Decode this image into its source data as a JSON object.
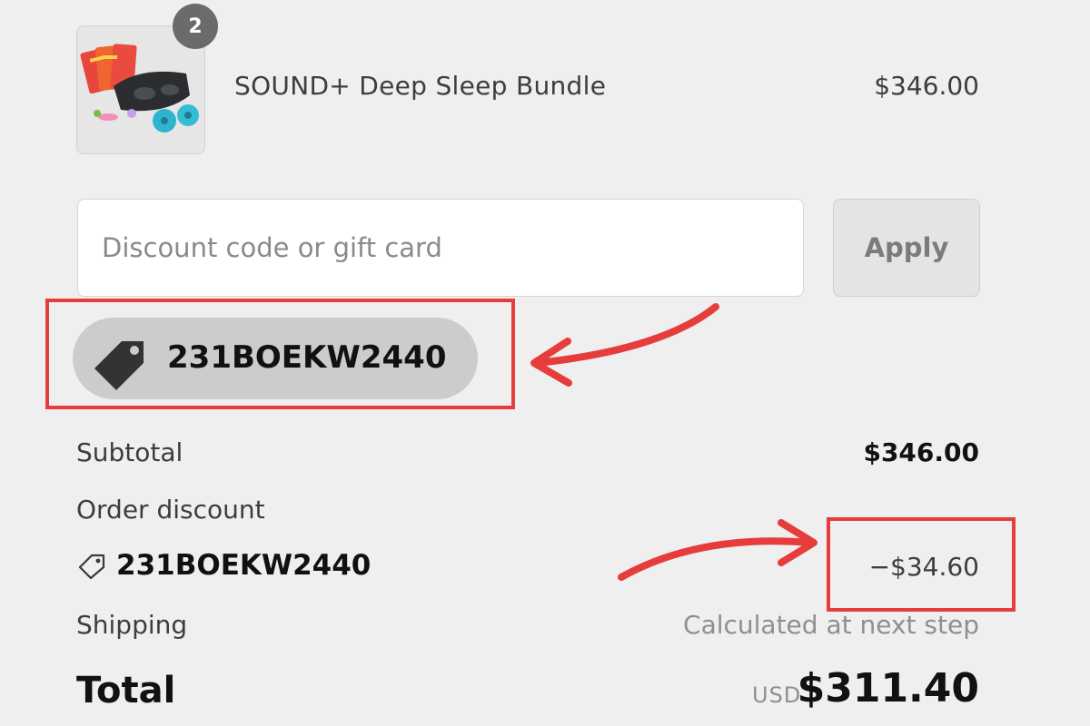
{
  "product": {
    "quantity": "2",
    "name": "SOUND+ Deep Sleep Bundle",
    "price": "$346.00",
    "image_icon": "product-bundle-image"
  },
  "discount": {
    "placeholder": "Discount code or gift card",
    "value": "",
    "apply_label": "Apply"
  },
  "applied_code": {
    "code": "231BOEKW2440",
    "icon": "tag-icon"
  },
  "summary": {
    "subtotal_label": "Subtotal",
    "subtotal_value": "$346.00",
    "order_discount_label": "Order discount",
    "discount_code": "231BOEKW2440",
    "discount_value": "−$34.60",
    "shipping_label": "Shipping",
    "shipping_value": "Calculated at next step",
    "total_label": "Total",
    "currency": "USD",
    "total_value": "$311.40"
  },
  "colors": {
    "background": "#efefef",
    "annotation": "#e63c3c",
    "chip": "#cdcbcb"
  }
}
